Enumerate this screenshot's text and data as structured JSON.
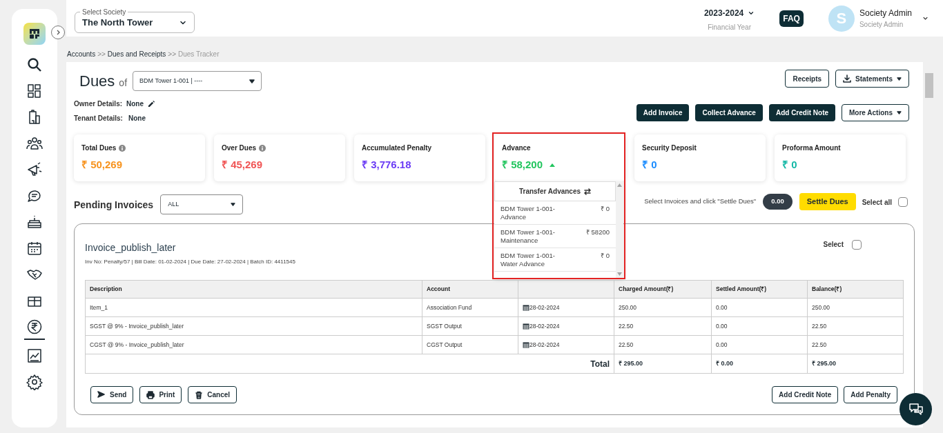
{
  "topbar": {
    "society_label": "Select Society",
    "society": "The North Tower",
    "year": "2023-2024",
    "year_caption": "Financial Year",
    "faq": "FAQ",
    "avatar_letter": "S",
    "user_name": "Society Admin",
    "user_role": "Society Admin"
  },
  "sidebar": {
    "items": [
      {
        "selected": false
      },
      {
        "selected": false
      },
      {
        "selected": false
      },
      {
        "selected": false
      },
      {
        "selected": false
      },
      {
        "selected": false
      },
      {
        "selected": false
      },
      {
        "selected": false
      },
      {
        "selected": false
      },
      {
        "selected": true
      },
      {
        "selected": false
      },
      {
        "selected": false
      }
    ]
  },
  "breadcrumb": [
    {
      "label": "Accounts",
      "current": false
    },
    {
      "label": "Dues and Receipts",
      "current": false
    },
    {
      "label": "Dues Tracker",
      "current": true
    }
  ],
  "breadcrumb_separator": ">>",
  "header": {
    "title": "Dues",
    "title_suffix": "of",
    "unit": "BDM Tower 1-001 | ----",
    "owner_label": "Owner Details:",
    "owner": "None",
    "tenant_label": "Tenant Details:",
    "tenant": "None"
  },
  "top_buttons": [
    "Receipts",
    "Statements"
  ],
  "action_buttons": [
    {
      "label": "Add Invoice",
      "kind": "solid"
    },
    {
      "label": "Collect Advance",
      "kind": "solid"
    },
    {
      "label": "Add Credit Note",
      "kind": "solid"
    },
    {
      "label": "More Actions",
      "kind": "menu"
    }
  ],
  "summary_cards": [
    {
      "label": "Total Dues",
      "value": "₹ 50,269",
      "color": "#f7931e",
      "info": true
    },
    {
      "label": "Over Dues",
      "value": "₹ 45,269",
      "color": "#f05454",
      "info": true
    },
    {
      "label": "Accumulated Penalty",
      "value": "₹ 3,776.18",
      "color": "#6b3cf5",
      "info": false
    },
    {
      "label": "Advance",
      "value": "₹ 58,200",
      "color": "#22c55e",
      "info": false,
      "expanded": true
    },
    {
      "label": "Security Deposit",
      "value": "₹ 0",
      "color": "#1a8cff",
      "info": false
    },
    {
      "label": "Proforma Amount",
      "value": "₹ 0",
      "color": "#14b8a6",
      "info": false
    }
  ],
  "advance_dropdown": {
    "header": "Transfer Advances",
    "items": [
      {
        "name": "BDM Tower 1-001-Advance",
        "amount": "₹ 0"
      },
      {
        "name": "BDM Tower 1-001-Maintenance",
        "amount": "₹ 58200"
      },
      {
        "name": "BDM Tower 1-001-Water Advance",
        "amount": "₹ 0"
      }
    ]
  },
  "pending": {
    "title": "Pending Invoices",
    "filter": "ALL",
    "hint": "Select Invoices and click \"Settle Dues\"",
    "selected_total": "0.00",
    "settle_button": "Settle Dues",
    "select_all_label": "Select all",
    "select_all_checked": false
  },
  "invoice": {
    "title": "Invoice_publish_later",
    "meta": "Inv No: Penalty/57 | Bill Date: 01-02-2024 | Due Date: 27-02-2024 | Batch ID: 4411545",
    "select_label": "Select",
    "selected": false,
    "table": {
      "columns": [
        "Description",
        "Account",
        null,
        "Charged Amount(₹)",
        "Settled Amount(₹)",
        "Balance(₹)"
      ],
      "rows": [
        [
          "Item_1",
          "Association Fund",
          "28-02-2024",
          "250.00",
          "0.00",
          "250.00"
        ],
        [
          "SGST @ 9% - Invoice_publish_later",
          "SGST Output",
          "28-02-2024",
          "22.50",
          "0.00",
          "22.50"
        ],
        [
          "CGST @ 9% - Invoice_publish_later",
          "CGST Output",
          "28-02-2024",
          "22.50",
          "0.00",
          "22.50"
        ]
      ],
      "total_label": "Total",
      "totals": [
        "₹ 295.00",
        "₹ 0.00",
        "₹ 295.00"
      ]
    },
    "left_buttons": [
      {
        "label": "Send",
        "kind": "send"
      },
      {
        "label": "Print",
        "kind": "print"
      },
      {
        "label": "Cancel",
        "kind": "cancel"
      }
    ],
    "right_buttons": [
      "Add Credit Note",
      "Add Penalty"
    ]
  }
}
